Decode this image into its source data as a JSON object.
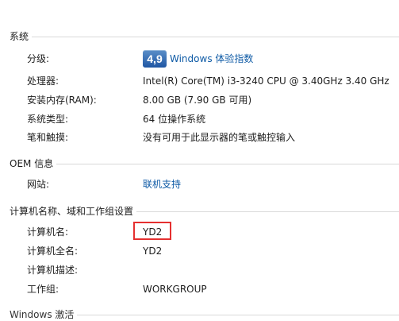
{
  "system": {
    "section_title": "系统",
    "rating_label": "分级:",
    "rating_score": "4,9",
    "rating_link": "Windows 体验指数",
    "processor_label": "处理器:",
    "processor_value": "Intel(R) Core(TM) i3-3240 CPU @ 3.40GHz   3.40 GHz",
    "ram_label": "安装内存(RAM):",
    "ram_value": "8.00 GB (7.90 GB 可用)",
    "type_label": "系统类型:",
    "type_value": "64 位操作系统",
    "pen_label": "笔和触摸:",
    "pen_value": "没有可用于此显示器的笔或触控输入"
  },
  "oem": {
    "section_title": "OEM 信息",
    "website_label": "网站:",
    "website_link": "联机支持"
  },
  "computer": {
    "section_title": "计算机名称、域和工作组设置",
    "name_label": "计算机名:",
    "name_value": "YD2",
    "fullname_label": "计算机全名:",
    "fullname_value": "YD2",
    "description_label": "计算机描述:",
    "description_value": "",
    "workgroup_label": "工作组:",
    "workgroup_value": "WORKGROUP"
  },
  "activation": {
    "section_title_partial": "Windows 激活"
  },
  "colors": {
    "link": "#0f5ba6",
    "highlight": "#e53030"
  }
}
